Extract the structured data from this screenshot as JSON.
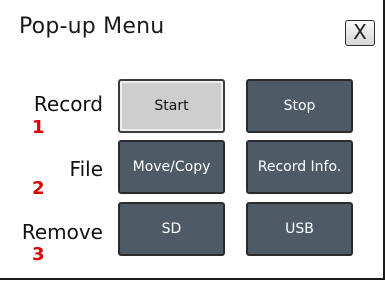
{
  "window": {
    "title": "Pop-up Menu",
    "close_label": "X"
  },
  "rows": [
    {
      "label": "Record",
      "number": "1",
      "buttons": [
        {
          "label": "Start",
          "selected": true
        },
        {
          "label": "Stop",
          "selected": false
        }
      ]
    },
    {
      "label": "File",
      "number": "2",
      "buttons": [
        {
          "label": "Move/Copy",
          "selected": false
        },
        {
          "label": "Record Info.",
          "selected": false
        }
      ]
    },
    {
      "label": "Remove",
      "number": "3",
      "buttons": [
        {
          "label": "SD",
          "selected": false
        },
        {
          "label": "USB",
          "selected": false
        }
      ]
    }
  ],
  "colors": {
    "button_fill": "#4e5a66",
    "button_selected_fill": "#cdcdcd",
    "number_red": "#e00000"
  }
}
